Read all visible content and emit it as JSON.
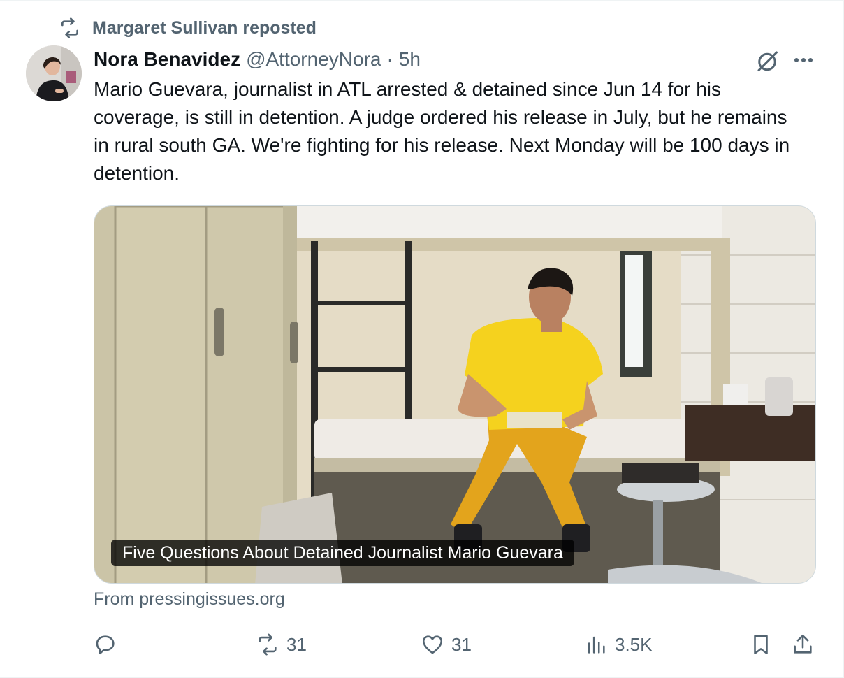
{
  "repost": {
    "text": "Margaret Sullivan reposted",
    "icon": "repost-icon"
  },
  "author": {
    "name": "Nora Benavidez",
    "handle": "@AttorneyNora",
    "separator": "·",
    "time": "5h"
  },
  "tweet": {
    "text": "Mario Guevara, journalist in ATL arrested & detained since Jun 14 for his coverage, is still in detention. A judge ordered his release in July, but he remains in rural south GA. We're fighting for his release. Next Monday will be 100 days in detention."
  },
  "media": {
    "caption": "Five Questions About Detained Journalist Mario Guevara"
  },
  "source": {
    "prefix": "From",
    "domain": "pressingissues.org"
  },
  "actions": {
    "reply": {
      "icon": "reply-icon",
      "count": ""
    },
    "repost": {
      "icon": "repost-icon",
      "count": "31"
    },
    "like": {
      "icon": "heart-icon",
      "count": "31"
    },
    "views": {
      "icon": "views-icon",
      "count": "3.5K"
    },
    "bookmark": {
      "icon": "bookmark-icon"
    },
    "share": {
      "icon": "share-icon"
    }
  },
  "colors": {
    "text": "#0f1419",
    "secondary": "#536471",
    "border": "#cfd9de",
    "shirt": "#f5d21e",
    "pants": "#e3a41c"
  }
}
